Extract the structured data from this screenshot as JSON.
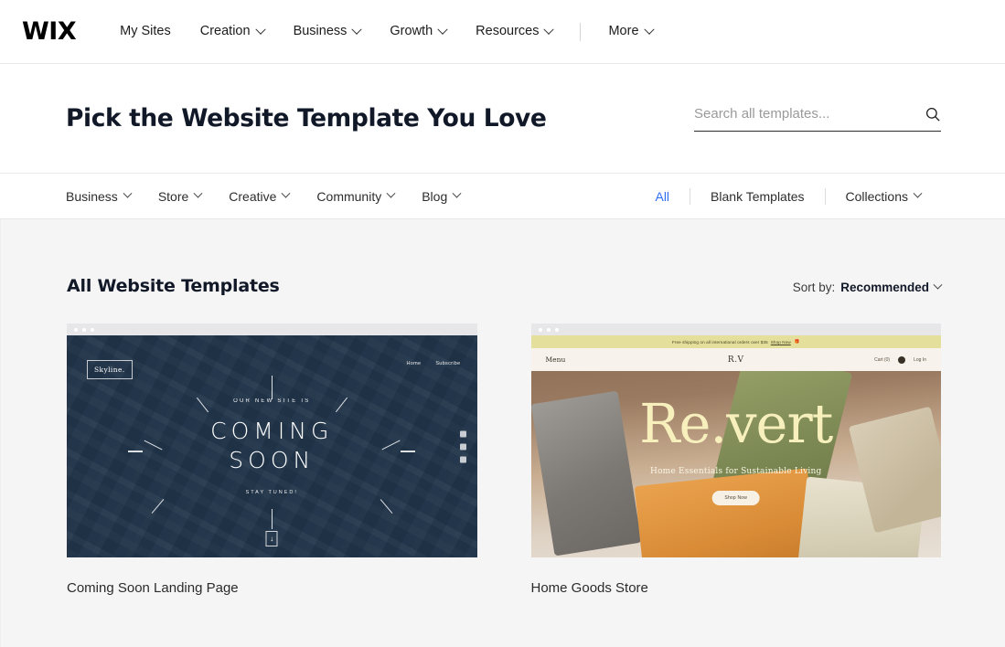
{
  "topnav": {
    "logo": "WIX",
    "items": [
      {
        "label": "My Sites",
        "has_chevron": false
      },
      {
        "label": "Creation",
        "has_chevron": true
      },
      {
        "label": "Business",
        "has_chevron": true
      },
      {
        "label": "Growth",
        "has_chevron": true
      },
      {
        "label": "Resources",
        "has_chevron": true
      }
    ],
    "more": {
      "label": "More",
      "has_chevron": true
    }
  },
  "hero": {
    "title": "Pick the Website Template You Love",
    "search": {
      "placeholder": "Search all templates...",
      "value": "",
      "icon": "search-icon"
    }
  },
  "filterbar": {
    "categories": [
      {
        "label": "Business",
        "has_chevron": true
      },
      {
        "label": "Store",
        "has_chevron": true
      },
      {
        "label": "Creative",
        "has_chevron": true
      },
      {
        "label": "Community",
        "has_chevron": true
      },
      {
        "label": "Blog",
        "has_chevron": true
      }
    ],
    "views": [
      {
        "label": "All",
        "active": true,
        "has_chevron": false
      },
      {
        "label": "Blank Templates",
        "active": false,
        "has_chevron": false
      },
      {
        "label": "Collections",
        "active": false,
        "has_chevron": true
      }
    ],
    "active_color": "#2f6ef3"
  },
  "main": {
    "section_title": "All Website Templates",
    "sort": {
      "prefix": "Sort by:",
      "value": "Recommended"
    },
    "cards": [
      {
        "label": "Coming Soon Landing Page",
        "preview": {
          "logo": "Skyline.",
          "nav": [
            "Home",
            "Subscribe"
          ],
          "kicker": "OUR NEW SITE IS",
          "headline_line1": "COMING",
          "headline_line2": "SOON",
          "tagline": "STAY TUNED!",
          "scroll_icon": "↓",
          "social_icons": [
            "facebook-icon",
            "twitter-icon",
            "instagram-icon"
          ]
        }
      },
      {
        "label": "Home Goods Store",
        "preview": {
          "banner_text": "Free shipping on all international orders over $35",
          "banner_link": "Shop Now",
          "banner_emoji": "🎁",
          "menu": "Menu",
          "brand": "R.V",
          "cart": "Cart (0)",
          "login": "Log In",
          "headline": "Re.vert",
          "subheadline": "Home Essentials for Sustainable Living",
          "cta": "Shop Now"
        }
      }
    ]
  }
}
